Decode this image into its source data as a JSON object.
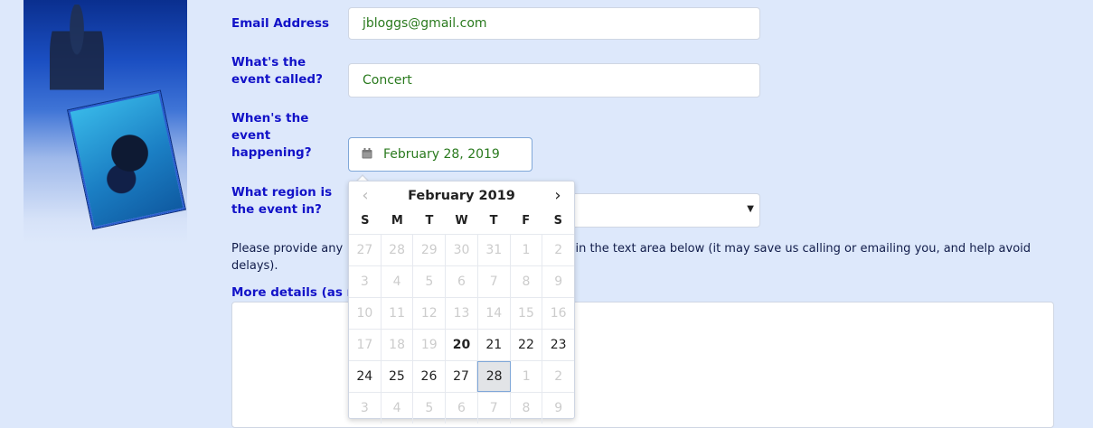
{
  "form": {
    "email_label": "Email Address",
    "email_value": "jbloggs@gmail.com",
    "event_name_label": "What's the event called?",
    "event_name_value": "Concert",
    "event_date_label": "When's the event happening?",
    "event_date_value": "February 28, 2019",
    "region_label": "What region is the event in?",
    "region_value": "",
    "note_start": "Please provide any ",
    "note_end": "us in the text area below (it may save us calling or emailing you, and help avoid delays).",
    "details_label": "More details (as m"
  },
  "calendar": {
    "title": "February 2019",
    "prev_icon": "chevron-left-icon",
    "next_icon": "chevron-right-icon",
    "weekdays": [
      "S",
      "M",
      "T",
      "W",
      "T",
      "F",
      "S"
    ],
    "weeks": [
      [
        "27",
        "28",
        "29",
        "30",
        "31",
        "1",
        "2"
      ],
      [
        "3",
        "4",
        "5",
        "6",
        "7",
        "8",
        "9"
      ],
      [
        "10",
        "11",
        "12",
        "13",
        "14",
        "15",
        "16"
      ],
      [
        "17",
        "18",
        "19",
        "20",
        "21",
        "22",
        "23"
      ],
      [
        "24",
        "25",
        "26",
        "27",
        "28",
        "1",
        "2"
      ],
      [
        "3",
        "4",
        "5",
        "6",
        "7",
        "8",
        "9"
      ]
    ],
    "today": "20",
    "selected": "28"
  },
  "colors": {
    "page_bg": "#dde8fb",
    "label": "#1212c8",
    "input_text": "#2a7a1e"
  }
}
